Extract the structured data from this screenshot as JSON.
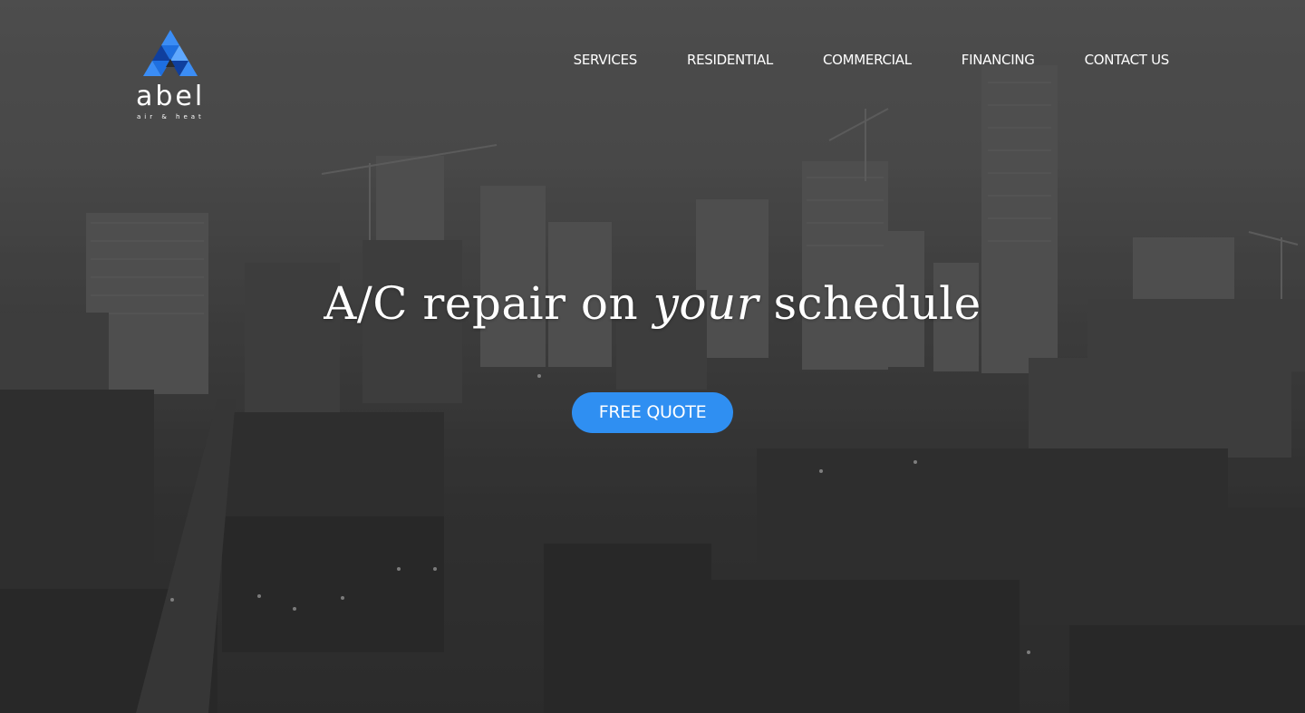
{
  "brand": {
    "name": "abel",
    "tagline": "air & heat",
    "logo_icon": "triangle-mosaic-logo",
    "colors": [
      "#1e6fe0",
      "#3b8df5",
      "#0f3f9e",
      "#5fa8ff"
    ]
  },
  "nav": {
    "items": [
      {
        "label": "SERVICES"
      },
      {
        "label": "RESIDENTIAL"
      },
      {
        "label": "COMMERCIAL"
      },
      {
        "label": "FINANCING"
      },
      {
        "label": "CONTACT US"
      }
    ]
  },
  "hero": {
    "headline_before": "A/C repair on",
    "headline_emphasis": "your",
    "headline_after": "schedule",
    "background": "grayscale city skyline",
    "cta_label": "FREE QUOTE",
    "cta_color": "#2f8ff2"
  }
}
